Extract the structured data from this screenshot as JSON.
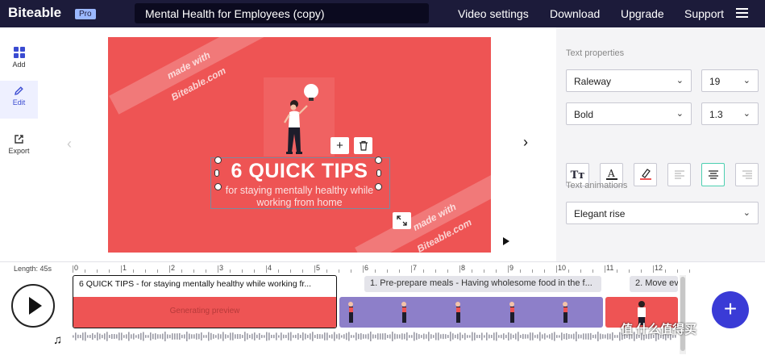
{
  "app": {
    "logo": "Biteable",
    "badge": "Pro",
    "project_title": "Mental Health for Employees (copy)"
  },
  "nav": [
    "Video settings",
    "Download",
    "Upgrade",
    "Support"
  ],
  "sidebar": [
    {
      "label": "Add",
      "icon": "grid-icon"
    },
    {
      "label": "Edit",
      "icon": "pencil-icon"
    },
    {
      "label": "Export",
      "icon": "export-icon"
    }
  ],
  "canvas": {
    "watermark_top": "made with\nBiteable.com",
    "watermark_bottom": "made with\nBiteable.com",
    "headline": "6 QUICK TIPS",
    "subline_1": "for staying mentally healthy while",
    "subline_2": "working from home",
    "background_color": "#ee5454"
  },
  "properties": {
    "text_properties_label": "Text properties",
    "font": "Raleway",
    "size": "19",
    "weight": "Bold",
    "line_height": "1.3",
    "text_animations_label": "Text animations",
    "animation": "Elegant rise"
  },
  "timeline": {
    "length_label": "Length: 45s",
    "ruler": [
      "0",
      "1",
      "2",
      "3",
      "4",
      "5",
      "6",
      "7",
      "8",
      "9",
      "10",
      "11",
      "12"
    ],
    "scenes": [
      {
        "title": "6 QUICK TIPS - for staying mentally healthy while working fr...",
        "status": "Generating preview"
      },
      {
        "title": "1. Pre-prepare meals - Having wholesome food in the f..."
      },
      {
        "title": "2. Move ev"
      }
    ],
    "add_label": "+",
    "watermark": "值 什么值得买"
  }
}
